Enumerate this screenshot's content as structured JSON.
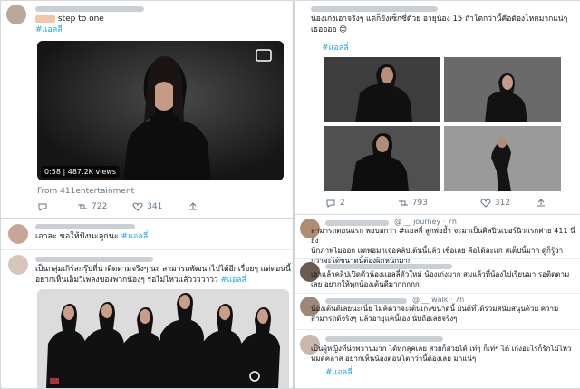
{
  "panel_a": {
    "caption": "step to one",
    "hashtag": "#แอลลี่",
    "video_time": "0:58",
    "video_views": "487.2K views",
    "source": "From 411entertainment",
    "retweets": "722",
    "likes": "341"
  },
  "panel_b": {
    "caption_line1": "น้องเก่งเอาจริงๆ แต่ก็ยังเซ็กซี่ด้วย อายุน้อง 15 ถ้าโตกว่านี้คือต้องโหดมากแน่ๆ",
    "caption_line2": "เธออออ 😊",
    "hashtag": "#แอลลี่",
    "replies": "2",
    "retweets": "793",
    "likes": "312"
  },
  "panel_c": {
    "reply1_text": "เอาละ ขอให้ปังนะลูกนะ ",
    "reply1_tag": "#แอลลี่",
    "reply2_line1": "เป็นกลุ่มเกิร์ลกรุ๊ปที่น่าติดตามจริงๆ นะ สามารถพัฒนาไปได้อีกเรื่อยๆ แต่ตอนนี้",
    "reply2_line2": "อยากเห็นเอ็มวีเพลงของพวกน้องๆ รอไม่ไหวแล้ววววววว ",
    "reply2_tag": "#แอลลี่"
  },
  "panel_d": {
    "handle1": "@ __ journey · 7h",
    "reply1_line1": "สามารถตอนแรก พอบอกว่า #แอลลี่ ลูกพ่อย้ำ จะมาเป็นศิลปินเบอร์นิวแรกค่าย 411 นี่ยัง",
    "reply1_line2": "นึกภาพไม่ออก แต่พอมาเจอคลิปเต้นนี้แล้ว เชื่อเลย คือได้ละแก สเต็ปนี้มาก ดูก็รู้ว่า",
    "reply1_line3": "กว่าจะได้ขนาดนี้ต้องฝึกหนักมาก",
    "reply2_line1": "เอาแล้วคลิปเปิดตัวน้องแอลลี่ตัวใหม่ น้องเก่งมาก สมแล้วที่น้องไปเรียนมา รอติดตาม",
    "reply2_line2": "เลย อยากให้ทุกน้องเต้นดีมากกกกก",
    "handle3": "@ __ walk · 7h",
    "reply3_line1": "น้องเต้นดีเลยนะเนี่ย ไม่คิดว่าจะเต้นเก่งขนาดนี้ ยินดีที่ได้ร่วมสนับสนุนด้วย ความ",
    "reply3_line2": "สามารถดีจริงๆ แล้วอายุแค่นี้เอง นับถือเลยจริงๆ",
    "reply4_line1": "เป็นผู้หญิงที่น่าพวานมาก ได้ทุกลุคเลย สวยก็สวยได้ เท่ๆ ก็เท่ๆ ได้ เก่งอะไรก็รักไม่ไหว",
    "reply4_line2": "หมดคลาส อยากเห็นน้องตอนโตกว่านี้ต้องเลย มาแน่ๆ",
    "hashtag": "#แอลลี่"
  }
}
